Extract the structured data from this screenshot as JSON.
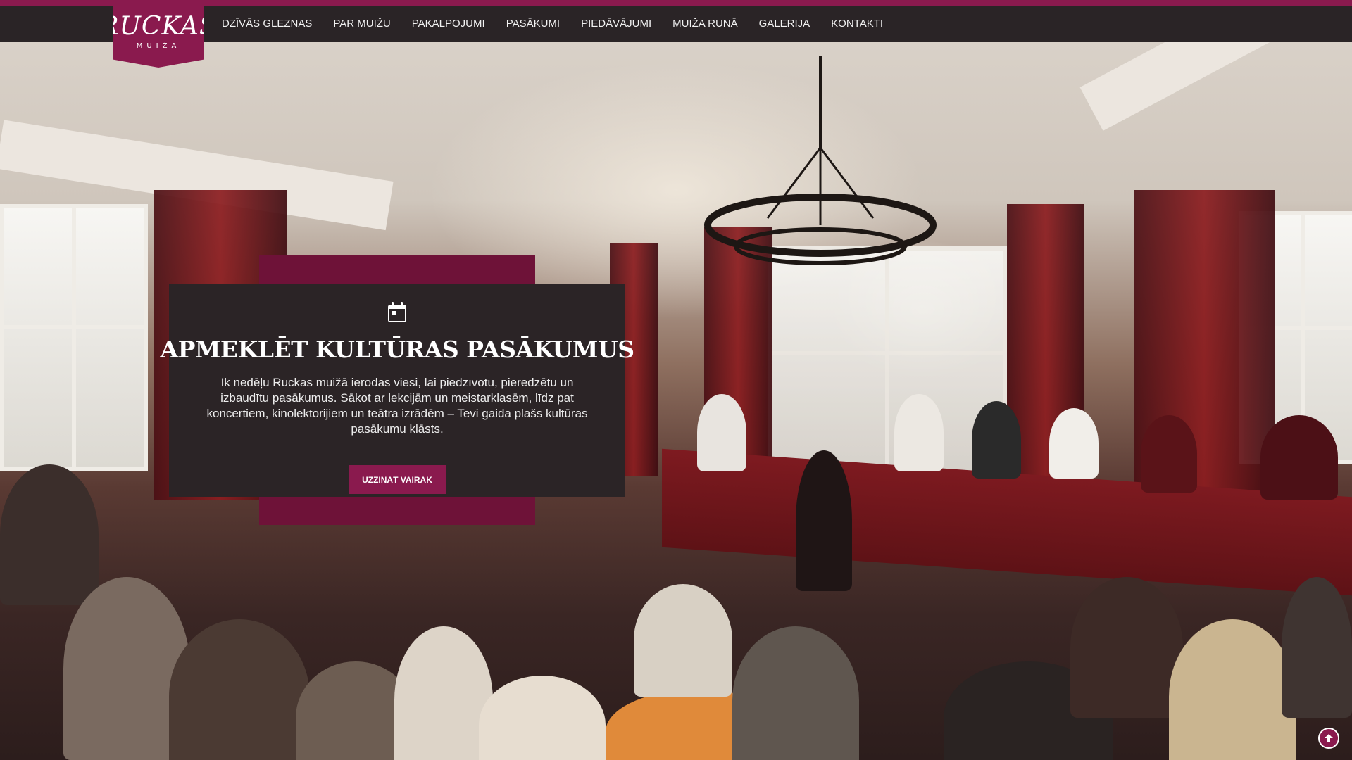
{
  "logo": {
    "name": "RUCKAS",
    "sub": "MUIŽA"
  },
  "nav": {
    "items": [
      {
        "label": "DZĪVĀS GLEZNAS"
      },
      {
        "label": "PAR MUIŽU"
      },
      {
        "label": "PAKALPOJUMI"
      },
      {
        "label": "PASĀKUMI"
      },
      {
        "label": "PIEDĀVĀJUMI"
      },
      {
        "label": "MUIŽA RUNĀ"
      },
      {
        "label": "GALERIJA"
      },
      {
        "label": "KONTAKTI"
      }
    ]
  },
  "hero": {
    "icon": "calendar-icon",
    "title": "APMEKLĒT KULTŪRAS PASĀKUMUS",
    "text": "Ik nedēļu Ruckas muižā ierodas viesi, lai piedzīvotu, pieredzētu un izbaudītu pasākumus. Sākot ar lekcijām un meistarklasēm, līdz pat koncertiem, kinolektorijiem un teātra izrādēm – Tevi gaida plašs kultūras pasākumu klāsts.",
    "button_label": "UZZINĀT VAIRĀK"
  },
  "colors": {
    "brand": "#8a1a4e",
    "nav_bg": "#2a2426",
    "card_bg": "#2b2426",
    "deco": "#6e1238"
  },
  "scroll_top": {
    "icon": "arrow-up-circle-icon"
  }
}
